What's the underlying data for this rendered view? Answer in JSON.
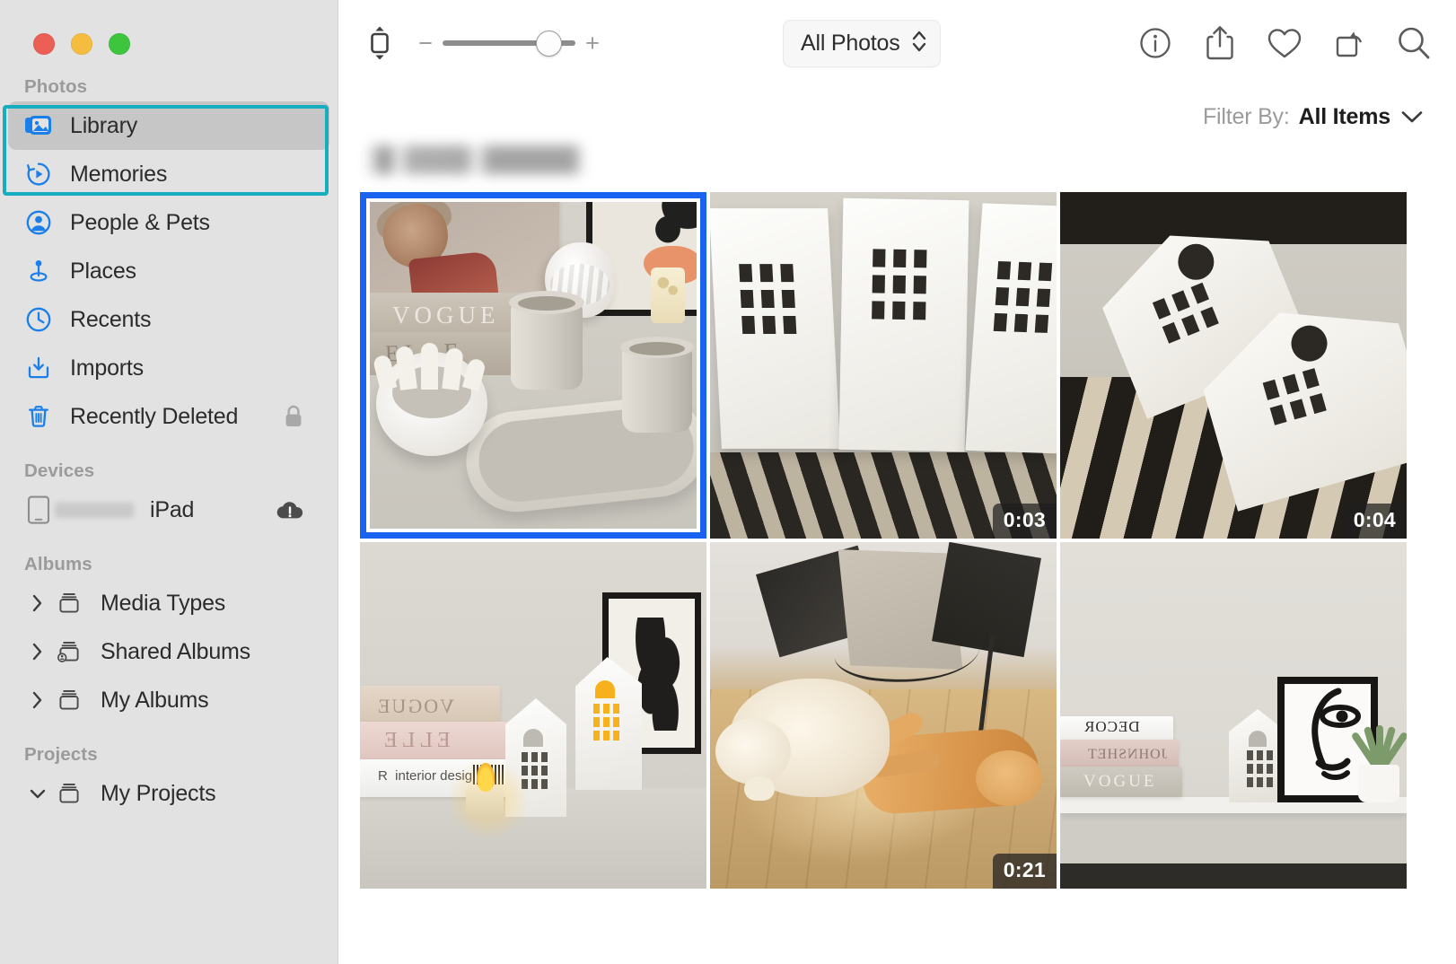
{
  "window": {
    "controls": [
      {
        "name": "close",
        "color": "#eb5f57"
      },
      {
        "name": "minimize",
        "color": "#f4bd3f"
      },
      {
        "name": "maximize",
        "color": "#3dc53d"
      }
    ]
  },
  "sidebar": {
    "sections": [
      {
        "title": "Photos",
        "items": [
          {
            "label": "Library",
            "icon": "library-icon",
            "selected": true
          },
          {
            "label": "Memories",
            "icon": "memories-icon",
            "selected": false
          },
          {
            "label": "People & Pets",
            "icon": "people-pets-icon",
            "selected": false
          },
          {
            "label": "Places",
            "icon": "places-icon",
            "selected": false
          },
          {
            "label": "Recents",
            "icon": "recents-clock-icon",
            "selected": false
          },
          {
            "label": "Imports",
            "icon": "imports-icon",
            "selected": false
          },
          {
            "label": "Recently Deleted",
            "icon": "trash-icon",
            "selected": false,
            "trailing": "lock-icon"
          }
        ]
      },
      {
        "title": "Devices",
        "items": [
          {
            "label": "iPad",
            "icon": "ipad-icon",
            "redacted_prefix": true,
            "trailing": "cloud-alert-icon"
          }
        ]
      },
      {
        "title": "Albums",
        "items": [
          {
            "label": "Media Types",
            "icon": "album-icon",
            "disclosure": "collapsed"
          },
          {
            "label": "Shared Albums",
            "icon": "shared-album-icon",
            "disclosure": "collapsed"
          },
          {
            "label": "My Albums",
            "icon": "album-icon",
            "disclosure": "collapsed"
          }
        ]
      },
      {
        "title": "Projects",
        "items": [
          {
            "label": "My Projects",
            "icon": "album-icon",
            "disclosure": "expanded"
          }
        ]
      }
    ],
    "highlight_color": "#16adbe"
  },
  "toolbar": {
    "view_mode_icon": "aspect-fit-icon",
    "zoom_out_label": "−",
    "zoom_in_label": "+",
    "zoom_slider_value": 72,
    "view_popup": {
      "label": "All Photos",
      "indicator_icon": "up-down-chevron-icon"
    },
    "actions": [
      {
        "name": "info-icon",
        "label": "Info"
      },
      {
        "name": "share-icon",
        "label": "Share"
      },
      {
        "name": "favorite-heart-icon",
        "label": "Favorite"
      },
      {
        "name": "rotate-icon",
        "label": "Rotate"
      },
      {
        "name": "search-icon",
        "label": "Search"
      }
    ]
  },
  "filter_bar": {
    "label": "Filter By:",
    "value": "All Items",
    "chevron_icon": "chevron-down-icon"
  },
  "grid": {
    "header_title_redacted": true,
    "selection_outline_color": "#16adbe",
    "selection_border_color": "#1a63f0",
    "items": [
      {
        "name": "photo-3d-printed-desk-set",
        "type": "photo",
        "selected": true,
        "duration": null,
        "scene": "s1"
      },
      {
        "name": "video-white-tiles",
        "type": "video",
        "selected": false,
        "duration": "0:03",
        "scene": "s2"
      },
      {
        "name": "video-paper-houses",
        "type": "video",
        "selected": false,
        "duration": "0:04",
        "scene": "s3"
      },
      {
        "name": "photo-candle-paper-houses",
        "type": "photo",
        "selected": false,
        "duration": null,
        "scene": "s4"
      },
      {
        "name": "video-cats-on-floor",
        "type": "video",
        "selected": false,
        "duration": "0:21",
        "scene": "s5"
      },
      {
        "name": "photo-shelf-decor",
        "type": "photo",
        "selected": false,
        "duration": null,
        "scene": "s6"
      }
    ]
  }
}
